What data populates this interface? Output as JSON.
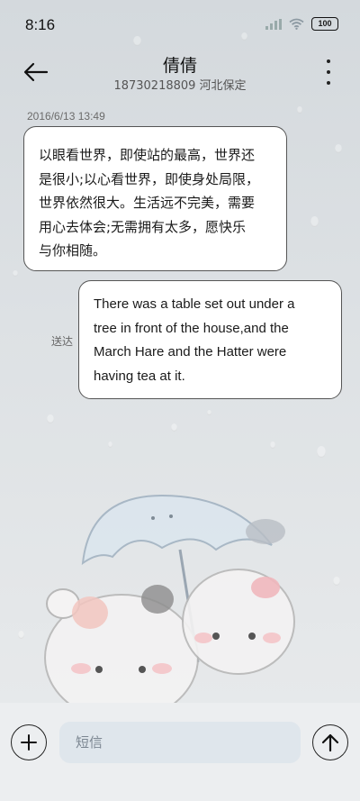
{
  "status_bar": {
    "time": "8:16",
    "battery": "100",
    "icons": [
      "signal-icon",
      "wifi-icon",
      "battery-icon"
    ]
  },
  "header": {
    "contact_name": "倩倩",
    "contact_detail": "18730218809 河北保定",
    "icons": [
      "back-arrow-icon",
      "more-vertical-icon"
    ]
  },
  "conversation": {
    "timestamp": "2016/6/13 13:49",
    "messages": [
      {
        "direction": "incoming",
        "lines": [
          "以眼看世界，即使站的最高，世界还",
          "是很小;以心看世界，即使身处局限，",
          "世界依然很大。生活远不完美，需要",
          "用心去体会;无需拥有太多，愿快乐",
          "与你相随。"
        ]
      },
      {
        "direction": "outgoing",
        "status": "送达",
        "lines": [
          "There was a table set out under a",
          "tree in front of the house,and the",
          "March Hare and the Hatter were",
          "having tea at it."
        ]
      }
    ]
  },
  "composer": {
    "placeholder": "短信",
    "value": "",
    "icons": [
      "add-icon",
      "send-arrow-icon"
    ]
  },
  "colors": {
    "background": "#dde1e4",
    "bubble": "#ffffff",
    "bubble_border": "#555555",
    "input_bg": "#dfe6ec"
  }
}
